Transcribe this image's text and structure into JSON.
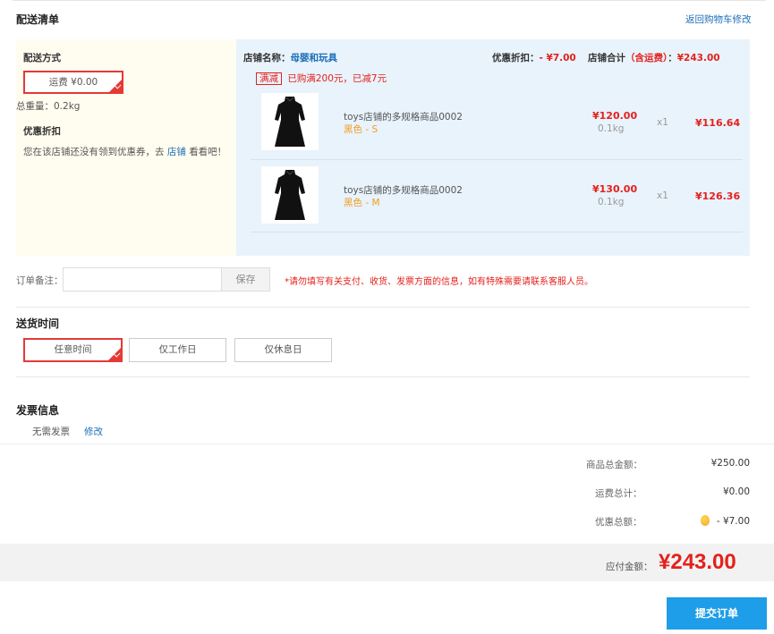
{
  "delivery": {
    "title": "配送清单",
    "back_link": "返回购物车修改",
    "method_label": "配送方式",
    "shipping_option": "运费 ¥0.00",
    "total_weight": "总重量：0.2kg",
    "discount_label": "优惠折扣",
    "coupon_text_pre": "您在该店铺还没有领到优惠券，去",
    "coupon_link": "店铺",
    "coupon_text_post": "看看吧！"
  },
  "shop": {
    "name_label": "店铺名称：",
    "name": "母婴和玩具",
    "discount_label": "优惠折扣：",
    "discount_value": "- ¥7.00",
    "total_label": "店铺合计",
    "total_note": "（含运费）",
    "total_colon": "：",
    "total_value": "¥243.00",
    "promo_tag": "满减",
    "promo_text": "已购满200元，已减7元"
  },
  "items": [
    {
      "name": "toys店铺的多规格商品0002",
      "spec": "黑色 - S",
      "price": "¥120.00",
      "weight": "0.1kg",
      "qty": "x1",
      "subtotal": "¥116.64"
    },
    {
      "name": "toys店铺的多规格商品0002",
      "spec": "黑色 - M",
      "price": "¥130.00",
      "weight": "0.1kg",
      "qty": "x1",
      "subtotal": "¥126.36"
    }
  ],
  "remark": {
    "label": "订单备注：",
    "value": "",
    "save": "保存",
    "tip": "*请勿填写有关支付、收货、发票方面的信息，如有特殊需要请联系客服人员。"
  },
  "delivery_time": {
    "title": "送货时间",
    "options": [
      "任意时间",
      "仅工作日",
      "仅休息日"
    ],
    "selected": 0
  },
  "invoice": {
    "title": "发票信息",
    "value": "无需发票",
    "edit": "修改"
  },
  "totals": {
    "goods_label": "商品总金额：",
    "goods_value": "¥250.00",
    "shipping_label": "运费总计：",
    "shipping_value": "¥0.00",
    "discount_label": "优惠总额：",
    "discount_value": "- ¥7.00",
    "payable_label": "应付金额：",
    "payable_value": "¥243.00"
  },
  "submit": "提交订单",
  "colors": {
    "accent_red": "#e4211c",
    "blue": "#1d6fb8",
    "button_blue": "#1e9de8",
    "orange": "#f29c1f"
  }
}
